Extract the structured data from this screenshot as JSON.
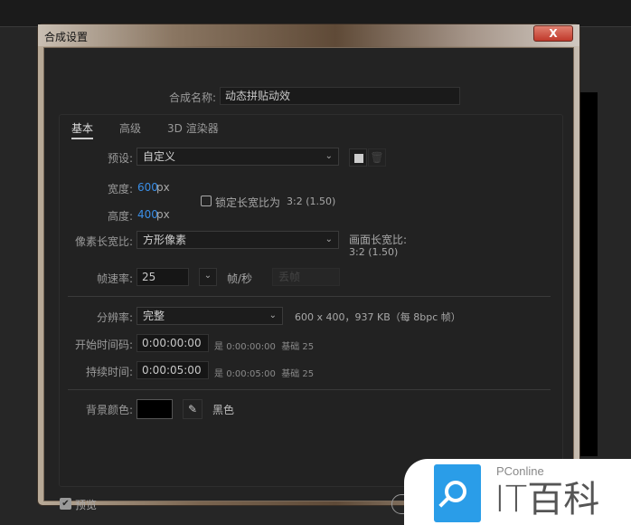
{
  "dialog": {
    "title": "合成设置",
    "close_label": "X"
  },
  "comp_name": {
    "label": "合成名称:",
    "value": "动态拼贴动效"
  },
  "tabs": [
    {
      "label": "基本",
      "active": true
    },
    {
      "label": "高级"
    },
    {
      "label": "3D 渲染器"
    }
  ],
  "preset": {
    "label": "预设:",
    "value": "自定义",
    "new_icon": "new-preset-icon",
    "delete_icon": "trash-icon"
  },
  "width": {
    "label": "宽度:",
    "value": "600",
    "unit": "px"
  },
  "height": {
    "label": "高度:",
    "value": "400",
    "unit": "px"
  },
  "lock_aspect": {
    "label": "锁定长宽比为",
    "ratio": "3:2 (1.50)",
    "checked": false
  },
  "pixel_aspect": {
    "label": "像素长宽比:",
    "value": "方形像素"
  },
  "frame_aspect": {
    "label": "画面长宽比:",
    "value": "3:2 (1.50)"
  },
  "frame_rate": {
    "label": "帧速率:",
    "value": "25",
    "unit": "帧/秒",
    "drop": "丢帧"
  },
  "resolution": {
    "label": "分辨率:",
    "value": "完整",
    "info": "600 x 400，937 KB（每 8bpc 帧）"
  },
  "start_timecode": {
    "label": "开始时间码:",
    "value": "0:00:00:00",
    "info_prefix": "是",
    "info_value": "0:00:00:00",
    "base": "基础 25"
  },
  "duration": {
    "label": "持续时间:",
    "value": "0:00:05:00",
    "info_prefix": "是",
    "info_value": "0:00:05:00",
    "base": "基础 25"
  },
  "background": {
    "label": "背景颜色:",
    "color": "#000000",
    "name": "黑色"
  },
  "preview": {
    "label": "预览",
    "checked": true
  },
  "watermark": {
    "brand": "PConline",
    "text": "IT百科"
  },
  "colors": {
    "accent": "#3a8ee6",
    "logo_blue": "#2a9de8"
  }
}
